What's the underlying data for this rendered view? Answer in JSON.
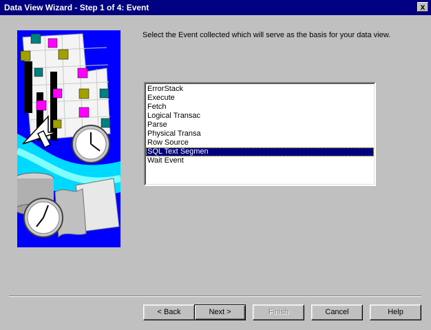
{
  "window": {
    "title": "Data View Wizard - Step 1 of 4:  Event",
    "close_label": "x"
  },
  "prompt": "Select the Event collected which will serve as the basis for your data view.",
  "events": {
    "items": [
      "ErrorStack",
      "Execute",
      "Fetch",
      "Logical Transac",
      "Parse",
      "Physical Transa",
      "Row Source",
      "SQL Text Segmen",
      "Wait Event"
    ],
    "selected": "SQL Text Segmen"
  },
  "buttons": {
    "back": {
      "label": "< Back",
      "enabled": true
    },
    "next": {
      "label": "Next >",
      "enabled": true,
      "default": true
    },
    "finish": {
      "label": "Finish",
      "enabled": false
    },
    "cancel": {
      "label": "Cancel",
      "enabled": true
    },
    "help": {
      "label": "Help",
      "enabled": true
    }
  },
  "icons": {
    "wizard_art": "data-view-wizard-illustration",
    "close": "close-icon"
  },
  "colors": {
    "title_bar": "#000080",
    "selection": "#000080",
    "art_background": "#0000ff",
    "face": "#c0c0c0"
  }
}
